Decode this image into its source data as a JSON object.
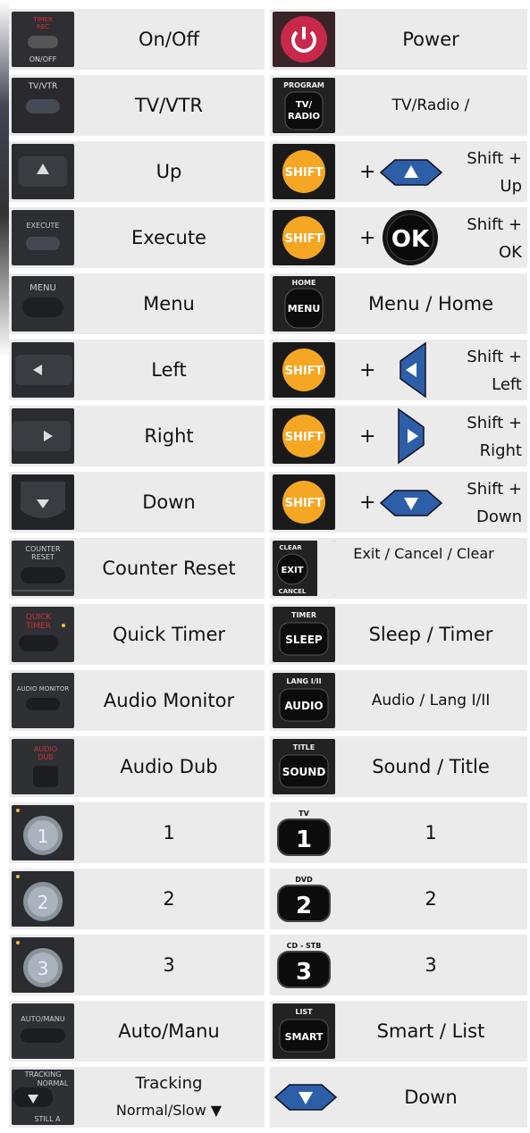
{
  "rows": [
    {
      "left": {
        "icon": "timer-rec-on-off-button-icon",
        "icon_text": [
          "TIMER",
          "REC",
          "ON/OFF"
        ],
        "label": "On/Off"
      },
      "right": {
        "icon": "power-button-icon",
        "label": "Power"
      }
    },
    {
      "left": {
        "icon": "tv-vtr-button-icon",
        "icon_text": [
          "TV/VTR"
        ],
        "label": "TV/VTR"
      },
      "right": {
        "icon": "tv-radio-button-icon",
        "icon_text": [
          "PROGRAM",
          "TV/",
          "RADIO"
        ],
        "label": "TV/Radio /"
      }
    },
    {
      "left": {
        "icon": "up-arrow-button-icon",
        "label": "Up"
      },
      "right": {
        "icon": "shift-button-icon",
        "combo_icon": "up-arrow-pad-icon",
        "shift_text": "SHIFT",
        "plus": "+",
        "label_lines": [
          "Shift +",
          "Up"
        ]
      }
    },
    {
      "left": {
        "icon": "execute-button-icon",
        "icon_text": [
          "EXECUTE"
        ],
        "label": "Execute"
      },
      "right": {
        "icon": "shift-button-icon",
        "combo_icon": "ok-button-icon",
        "shift_text": "SHIFT",
        "combo_text": "OK",
        "plus": "+",
        "label_lines": [
          "Shift +",
          "OK"
        ]
      }
    },
    {
      "left": {
        "icon": "menu-button-icon",
        "icon_text": [
          "MENU"
        ],
        "label": "Menu"
      },
      "right": {
        "icon": "menu-home-button-icon",
        "icon_text": [
          "HOME",
          "MENU"
        ],
        "label": "Menu / Home"
      }
    },
    {
      "left": {
        "icon": "left-arrow-button-icon",
        "label": "Left"
      },
      "right": {
        "icon": "shift-button-icon",
        "combo_icon": "left-arrow-pad-icon",
        "shift_text": "SHIFT",
        "plus": "+",
        "label_lines": [
          "Shift +",
          "Left"
        ]
      }
    },
    {
      "left": {
        "icon": "right-arrow-button-icon",
        "label": "Right"
      },
      "right": {
        "icon": "shift-button-icon",
        "combo_icon": "right-arrow-pad-icon",
        "shift_text": "SHIFT",
        "plus": "+",
        "label_lines": [
          "Shift +",
          "Right"
        ]
      }
    },
    {
      "left": {
        "icon": "down-arrow-button-icon",
        "label": "Down"
      },
      "right": {
        "icon": "shift-button-icon",
        "combo_icon": "down-arrow-pad-icon",
        "shift_text": "SHIFT",
        "plus": "+",
        "label_lines": [
          "Shift +",
          "Down"
        ]
      }
    },
    {
      "left": {
        "icon": "counter-reset-button-icon",
        "icon_text": [
          "COUNTER",
          "RESET"
        ],
        "label": "Counter Reset"
      },
      "right": {
        "icon": "exit-button-icon",
        "icon_text": [
          "CLEAR",
          "EXIT",
          "CANCEL"
        ],
        "label": "Exit / Cancel / Clear"
      }
    },
    {
      "left": {
        "icon": "quick-timer-button-icon",
        "icon_text": [
          "QUICK",
          "TIMER"
        ],
        "label": "Quick Timer"
      },
      "right": {
        "icon": "sleep-timer-button-icon",
        "icon_text": [
          "TIMER",
          "SLEEP"
        ],
        "label": "Sleep / Timer"
      }
    },
    {
      "left": {
        "icon": "audio-monitor-button-icon",
        "icon_text": [
          "AUDIO MONITOR"
        ],
        "label": "Audio Monitor"
      },
      "right": {
        "icon": "audio-lang-button-icon",
        "icon_text": [
          "LANG I/II",
          "AUDIO"
        ],
        "label": "Audio / Lang I/II"
      }
    },
    {
      "left": {
        "icon": "audio-dub-button-icon",
        "icon_text": [
          "AUDIO",
          "DUB"
        ],
        "label": "Audio Dub"
      },
      "right": {
        "icon": "sound-title-button-icon",
        "icon_text": [
          "TITLE",
          "SOUND"
        ],
        "label": "Sound / Title"
      }
    },
    {
      "left": {
        "icon": "number-1-button-icon",
        "icon_text": [
          "1"
        ],
        "label": "1"
      },
      "right": {
        "icon": "number-1-tv-button-icon",
        "icon_text": [
          "TV",
          "1"
        ],
        "label": "1"
      }
    },
    {
      "left": {
        "icon": "number-2-button-icon",
        "icon_text": [
          "2"
        ],
        "label": "2"
      },
      "right": {
        "icon": "number-2-dvd-button-icon",
        "icon_text": [
          "DVD",
          "2"
        ],
        "label": "2"
      }
    },
    {
      "left": {
        "icon": "number-3-button-icon",
        "icon_text": [
          "3"
        ],
        "label": "3"
      },
      "right": {
        "icon": "number-3-cd-stb-button-icon",
        "icon_text": [
          "CD - STB",
          "3"
        ],
        "label": "3"
      }
    },
    {
      "left": {
        "icon": "auto-manu-button-icon",
        "icon_text": [
          "AUTO/MANU"
        ],
        "label": "Auto/Manu"
      },
      "right": {
        "icon": "smart-list-button-icon",
        "icon_text": [
          "LIST",
          "SMART"
        ],
        "label": "Smart / List"
      }
    },
    {
      "left": {
        "icon": "tracking-button-icon",
        "icon_text": [
          "TRACKING",
          "NORMAL",
          "STILL A"
        ],
        "label_lines": [
          "Tracking",
          "Normal/Slow ▼"
        ]
      },
      "right": {
        "icon": "down-arrow-pad-icon",
        "label": "Down"
      }
    }
  ],
  "colors": {
    "cell_bg": "#ebebeb",
    "shift_orange": "#f5a623",
    "pad_blue": "#2d5fa8",
    "power_red": "#c8284a"
  }
}
